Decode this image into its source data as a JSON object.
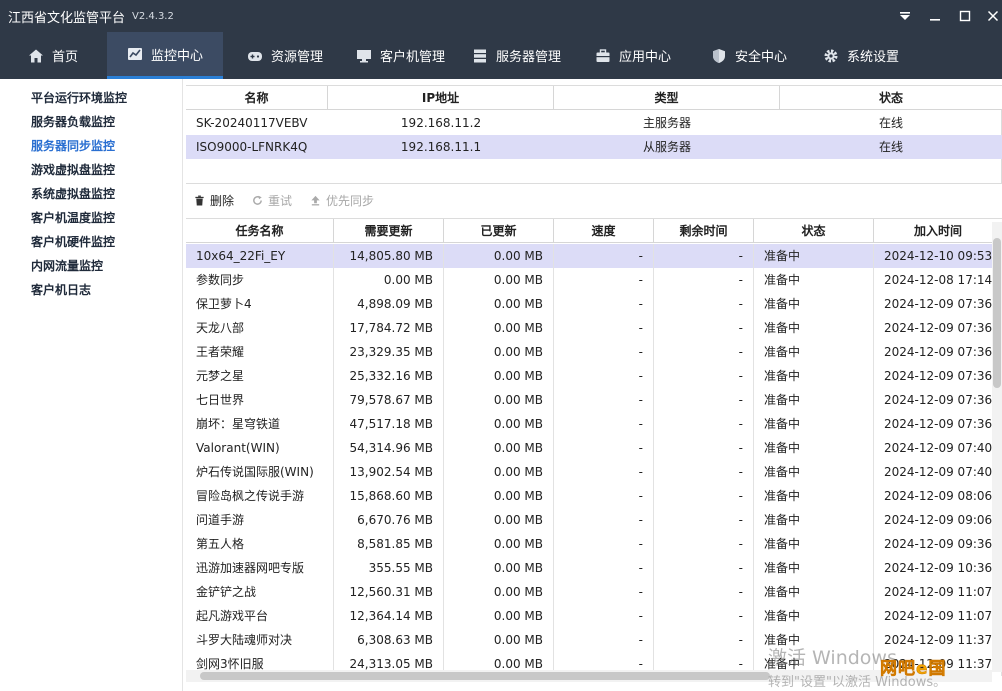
{
  "app": {
    "title": "江西省文化监管平台",
    "version": "V2.4.3.2"
  },
  "nav": [
    {
      "label": "首页",
      "icon": "home-icon"
    },
    {
      "label": "监控中心",
      "icon": "chart-icon"
    },
    {
      "label": "资源管理",
      "icon": "gamepad-icon"
    },
    {
      "label": "客户机管理",
      "icon": "monitor-icon"
    },
    {
      "label": "服务器管理",
      "icon": "server-icon"
    },
    {
      "label": "应用中心",
      "icon": "briefcase-icon"
    },
    {
      "label": "安全中心",
      "icon": "shield-icon"
    },
    {
      "label": "系统设置",
      "icon": "gear-icon"
    }
  ],
  "sidebar": [
    "平台运行环境监控",
    "服务器负载监控",
    "服务器同步监控",
    "游戏虚拟盘监控",
    "系统虚拟盘监控",
    "客户机温度监控",
    "客户机硬件监控",
    "内网流量监控",
    "客户机日志"
  ],
  "servers": {
    "headers": [
      "名称",
      "IP地址",
      "类型",
      "状态"
    ],
    "rows": [
      [
        "SK-20240117VEBV",
        "192.168.11.2",
        "主服务器",
        "在线"
      ],
      [
        "ISO9000-LFNRK4Q",
        "192.168.11.1",
        "从服务器",
        "在线"
      ]
    ]
  },
  "toolbar": {
    "delete": "删除",
    "retry": "重试",
    "priority": "优先同步"
  },
  "tasks": {
    "headers": [
      "任务名称",
      "需要更新",
      "已更新",
      "速度",
      "剩余时间",
      "状态",
      "加入时间"
    ],
    "rows": [
      [
        "10x64_22Fi_EY",
        "14,805.80 MB",
        "0.00 MB",
        "-",
        "-",
        "准备中",
        "2024-12-10 09:53:"
      ],
      [
        "参数同步",
        "0.00 MB",
        "0.00 MB",
        "-",
        "-",
        "准备中",
        "2024-12-08 17:14:"
      ],
      [
        "保卫萝卜4",
        "4,898.09 MB",
        "0.00 MB",
        "-",
        "-",
        "准备中",
        "2024-12-09 07:36:"
      ],
      [
        "天龙八部",
        "17,784.72 MB",
        "0.00 MB",
        "-",
        "-",
        "准备中",
        "2024-12-09 07:36:"
      ],
      [
        "王者荣耀",
        "23,329.35 MB",
        "0.00 MB",
        "-",
        "-",
        "准备中",
        "2024-12-09 07:36:"
      ],
      [
        "元梦之星",
        "25,332.16 MB",
        "0.00 MB",
        "-",
        "-",
        "准备中",
        "2024-12-09 07:36:"
      ],
      [
        "七日世界",
        "79,578.67 MB",
        "0.00 MB",
        "-",
        "-",
        "准备中",
        "2024-12-09 07:36:"
      ],
      [
        "崩坏：星穹铁道",
        "47,517.18 MB",
        "0.00 MB",
        "-",
        "-",
        "准备中",
        "2024-12-09 07:36:"
      ],
      [
        "Valorant(WIN)",
        "54,314.96 MB",
        "0.00 MB",
        "-",
        "-",
        "准备中",
        "2024-12-09 07:40:"
      ],
      [
        "炉石传说国际服(WIN)",
        "13,902.54 MB",
        "0.00 MB",
        "-",
        "-",
        "准备中",
        "2024-12-09 07:40:"
      ],
      [
        "冒险岛枫之传说手游",
        "15,868.60 MB",
        "0.00 MB",
        "-",
        "-",
        "准备中",
        "2024-12-09 08:06:"
      ],
      [
        "问道手游",
        "6,670.76 MB",
        "0.00 MB",
        "-",
        "-",
        "准备中",
        "2024-12-09 09:06:"
      ],
      [
        "第五人格",
        "8,581.85 MB",
        "0.00 MB",
        "-",
        "-",
        "准备中",
        "2024-12-09 09:36:"
      ],
      [
        "迅游加速器网吧专版",
        "355.55 MB",
        "0.00 MB",
        "-",
        "-",
        "准备中",
        "2024-12-09 10:36:"
      ],
      [
        "金铲铲之战",
        "12,560.31 MB",
        "0.00 MB",
        "-",
        "-",
        "准备中",
        "2024-12-09 11:07:"
      ],
      [
        "起凡游戏平台",
        "12,364.14 MB",
        "0.00 MB",
        "-",
        "-",
        "准备中",
        "2024-12-09 11:07:"
      ],
      [
        "斗罗大陆魂师对决",
        "6,308.63 MB",
        "0.00 MB",
        "-",
        "-",
        "准备中",
        "2024-12-09 11:37:"
      ],
      [
        "剑网3怀旧服",
        "24,313.05 MB",
        "0.00 MB",
        "-",
        "-",
        "准备中",
        "2024-12-09 11:37:"
      ]
    ]
  },
  "watermark": {
    "line1": "激活 Windows",
    "line2": "转到\"设置\"以激活 Windows。"
  },
  "logo_text": "网吧e国",
  "colors": {
    "titlebar": "#2f3947",
    "nav_active": "#3c4b63",
    "accent": "#2a6fd1",
    "selected_row": "#dcdcf7"
  }
}
